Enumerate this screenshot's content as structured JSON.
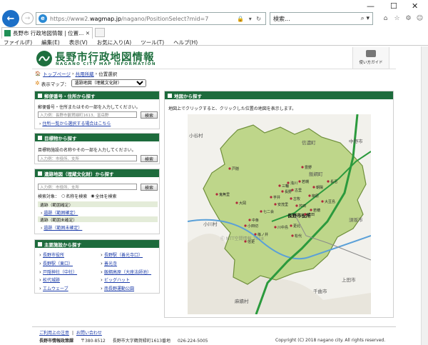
{
  "browser": {
    "url_prefix": "https://www2.",
    "url_host": "wagmap.jp",
    "url_path": "/nagano/PositionSelect?mid=7",
    "search_placeholder": "検索...",
    "tab_title": "長野市 行政地図情報 | 位置...",
    "menu": [
      "ファイル(F)",
      "編集(E)",
      "表示(V)",
      "お気に入り(A)",
      "ツール(T)",
      "ヘルプ(H)"
    ]
  },
  "site": {
    "logo_jp": "長野市行政地図情報",
    "logo_en": "NAGANO CITY MAP INFORMATION",
    "guide_label": "使い方ガイド",
    "breadcrumb": [
      "トップページ",
      "共用所蔵",
      "位置選択"
    ],
    "map_select_label": "表示マップ：",
    "map_select_value": "遺跡地図（埋蔵文化財）"
  },
  "panels": {
    "address": {
      "title": "郵便番号・住所から探す",
      "desc": "郵便番号・住所またはその一部を入力してください。",
      "placeholder": "入力例：長野市鶴賀緑町1613、富岳野",
      "button": "検索",
      "link": "住所一覧から選択する場合はこちら"
    },
    "landmark": {
      "title": "目標物から探す",
      "desc": "目標物施設の名称やその一部を入力してください。",
      "placeholder": "入力例：市役所、支所",
      "button": "検索"
    },
    "ruins": {
      "title": "遺跡地図（埋蔵文化財）から探す",
      "placeholder": "入力例：市役所、支所",
      "button": "検索",
      "target_label": "検索対象：",
      "option_name": "名称を検索",
      "option_all": "全体を検索",
      "group1": "遺跡（範囲確定）",
      "link1": "遺跡（範囲確定）",
      "group2": "遺跡（範囲未確定）",
      "link2": "遺跡（範囲未確定）"
    },
    "facilities": {
      "title": "主要施設から探す",
      "left": [
        "長野市役所",
        "長野駅（東口）",
        "戸隠神社（中社）",
        "松代城跡",
        "エムウェーブ"
      ],
      "right": [
        "長野駅（善光寺口）",
        "善光寺",
        "飯綱高原（大座法師池）",
        "ビッグハット",
        "南長野運動公園"
      ]
    },
    "map": {
      "title": "地図から探す",
      "desc": "地図上でクリックすると、クリックした位置の地図を表示します。",
      "watermark": "Ⓒ NTT空間情報 2018",
      "labels": [
        {
          "text": "小谷村"
        },
        {
          "text": "信濃町"
        },
        {
          "text": "飯綱町"
        },
        {
          "text": "中野市"
        },
        {
          "text": "須坂市"
        },
        {
          "text": "長野市役所"
        },
        {
          "text": "小川村"
        },
        {
          "text": "千曲市"
        },
        {
          "text": "上田市"
        },
        {
          "text": "麻績村"
        },
        {
          "text": "長野"
        },
        {
          "text": "戸隠"
        },
        {
          "text": "鬼無里"
        },
        {
          "text": "大岡"
        },
        {
          "text": "信更"
        },
        {
          "text": "中条"
        },
        {
          "text": "篠ノ井"
        },
        {
          "text": "松代"
        },
        {
          "text": "若穂"
        },
        {
          "text": "豊野"
        },
        {
          "text": "七二会"
        },
        {
          "text": "浅川"
        },
        {
          "text": "芋井"
        },
        {
          "text": "古里"
        },
        {
          "text": "柳原"
        },
        {
          "text": "若槻"
        },
        {
          "text": "長沼"
        },
        {
          "text": "朝陽"
        },
        {
          "text": "大豆島"
        },
        {
          "text": "更北"
        },
        {
          "text": "安茂里"
        },
        {
          "text": "小田切"
        },
        {
          "text": "川中島"
        },
        {
          "text": "芹田"
        },
        {
          "text": "吉田"
        },
        {
          "text": "古牧"
        },
        {
          "text": "三輪"
        }
      ],
      "colors": {
        "land": "#bed68a",
        "outline": "#6f8f3b",
        "road": "#2b9a3d",
        "point": "#b0273a",
        "river": "#5aa0d8"
      }
    }
  },
  "footer": {
    "links": [
      "ご利用上の注意",
      "お問い合わせ"
    ],
    "org": "長野市情報政策課",
    "postal": "〒380-8512",
    "address": "長野市大字鶴賀緑町1613番地",
    "phone": "026-224-5005",
    "copyright": "Copyright (C) 2018 nagano city. All rights reserved."
  }
}
